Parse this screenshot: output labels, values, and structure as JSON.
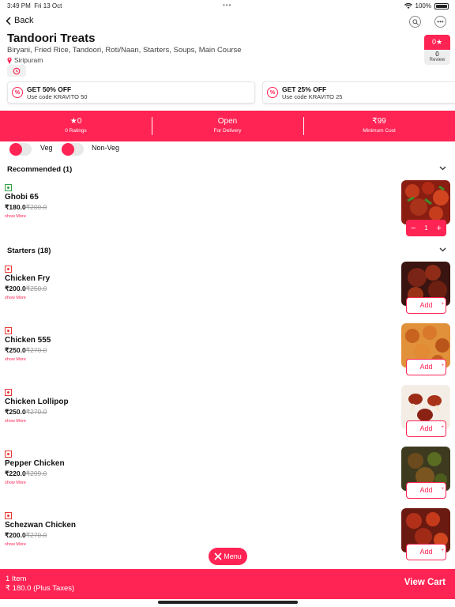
{
  "status_bar": {
    "time": "3:49 PM",
    "date": "Fri 13 Oct",
    "battery": "100%"
  },
  "nav": {
    "back_label": "Back"
  },
  "restaurant": {
    "name": "Tandoori Treats",
    "cuisines": "Biryani, Fried Rice, Tandoori, Roti/Naan, Starters, Soups, Main Course",
    "location": "Siripuram",
    "rating_badge": "0★",
    "review_count": "0",
    "review_label": "Review"
  },
  "offers": [
    {
      "title": "GET 50% OFF",
      "code": "Use code KRAVITO 50"
    },
    {
      "title": "GET 25% OFF",
      "code": "Use code KRAVITO 25"
    }
  ],
  "info_band": {
    "rating_value": "0",
    "rating_label": "0 Ratings",
    "status_value": "Open",
    "status_label": "For Delivery",
    "min_cost_value": "₹99",
    "min_cost_label": "Minimum Cost"
  },
  "filters": {
    "veg_label": "Veg",
    "nonveg_label": "Non-Veg"
  },
  "sections": {
    "recommended": "Recommended (1)",
    "starters": "Starters (18)"
  },
  "recommended_items": [
    {
      "name": "Ghobi 65",
      "price": "₹180.0",
      "old_price": "₹200.0",
      "more": "show More",
      "qty": "1",
      "type": "veg"
    }
  ],
  "starter_items": [
    {
      "name": "Chicken Fry",
      "price": "₹200.0",
      "old_price": "₹250.0",
      "more": "show More",
      "add": "Add",
      "type": "nonveg"
    },
    {
      "name": "Chicken 555",
      "price": "₹250.0",
      "old_price": "₹270.0",
      "more": "show More",
      "add": "Add",
      "type": "nonveg"
    },
    {
      "name": "Chicken Lollipop",
      "price": "₹250.0",
      "old_price": "₹270.0",
      "more": "show More",
      "add": "Add",
      "type": "nonveg"
    },
    {
      "name": "Pepper Chicken",
      "price": "₹220.0",
      "old_price": "₹299.0",
      "more": "show More",
      "add": "Add",
      "type": "nonveg"
    },
    {
      "name": "Schezwan Chicken",
      "price": "₹200.0",
      "old_price": "₹270.0",
      "more": "show More",
      "add": "Add",
      "type": "nonveg"
    }
  ],
  "menu_button": "Menu",
  "cart": {
    "items": "1 Item",
    "total": "₹ 180.0 (Plus Taxes)",
    "cta": "View Cart"
  },
  "colors": {
    "accent": "#ff2454",
    "veg": "#2e9d44",
    "nonveg": "#e53935"
  }
}
